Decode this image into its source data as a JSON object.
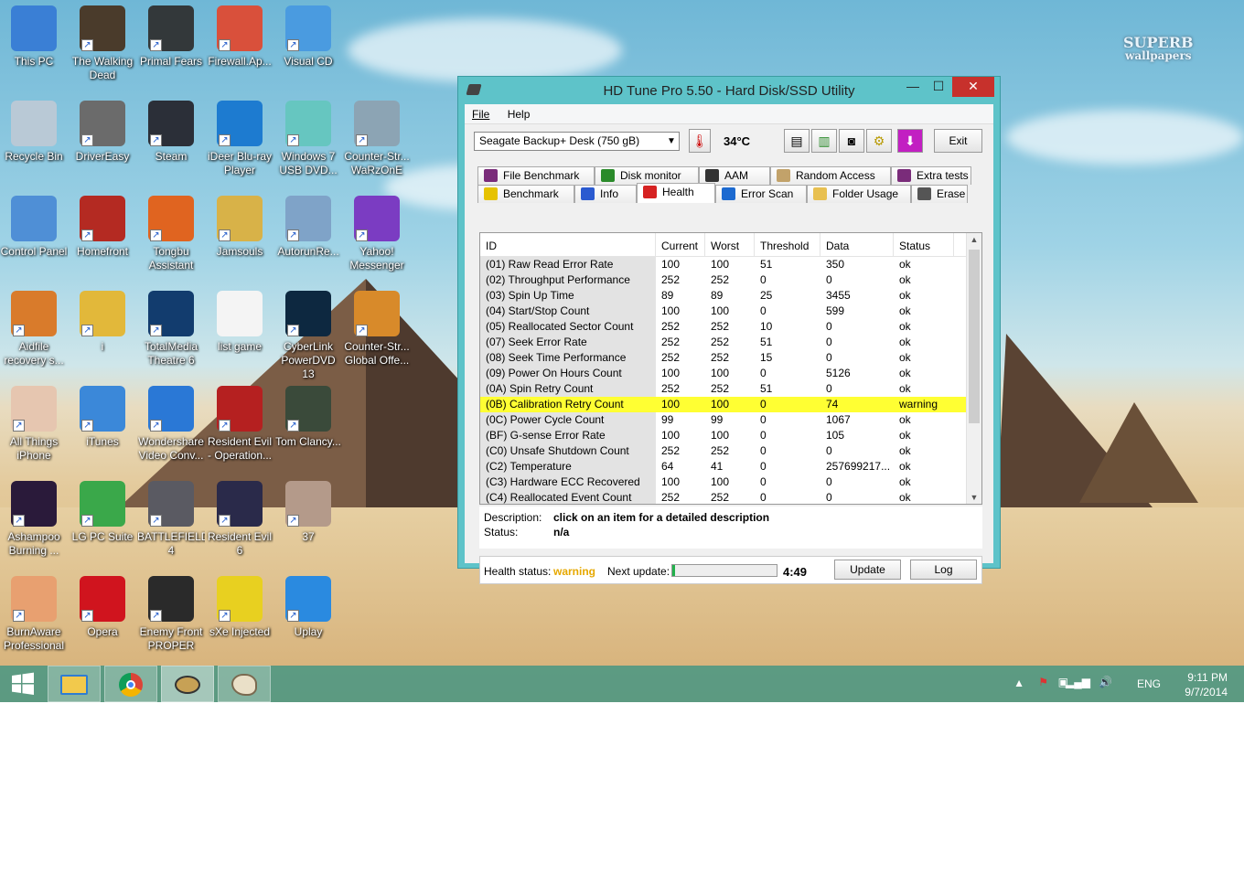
{
  "desktop": {
    "watermark": [
      "SUPERB",
      "wallpapers"
    ],
    "icons": [
      {
        "label": "This PC",
        "icon": "computer-icon",
        "color": "#3a7fd5"
      },
      {
        "label": "The Walking Dead",
        "icon": "game-icon",
        "color": "#4a3b2b"
      },
      {
        "label": "Primal Fears",
        "icon": "game-icon",
        "color": "#33383a"
      },
      {
        "label": "Firewall.Ap...",
        "icon": "firewall-icon",
        "color": "#d9503b"
      },
      {
        "label": "Visual CD",
        "icon": "disc-icon",
        "color": "#4a9be0"
      },
      {
        "label": "Recycle Bin",
        "icon": "recycle-bin-icon",
        "color": "#b9c9d6"
      },
      {
        "label": "DriverEasy",
        "icon": "magnifier-icon",
        "color": "#6b6b6b"
      },
      {
        "label": "Steam",
        "icon": "steam-icon",
        "color": "#2b2f38"
      },
      {
        "label": "iDeer Blu-ray Player",
        "icon": "play-icon",
        "color": "#1d7bd0"
      },
      {
        "label": "Windows 7 USB DVD...",
        "icon": "usb-icon",
        "color": "#66c6c0"
      },
      {
        "label": "Counter-Str... WaRzOnE",
        "icon": "game-icon",
        "color": "#8ca4b4"
      },
      {
        "label": "Control Panel",
        "icon": "control-panel-icon",
        "color": "#4f8fd6"
      },
      {
        "label": "Homefront",
        "icon": "game-icon",
        "color": "#b42a22"
      },
      {
        "label": "Tongbu Assistant",
        "icon": "tongbu-icon",
        "color": "#e06420"
      },
      {
        "label": "Jamsouls",
        "icon": "music-icon",
        "color": "#d8b248"
      },
      {
        "label": "AutorunRe...",
        "icon": "autorun-icon",
        "color": "#7fa3c8"
      },
      {
        "label": "Yahoo! Messenger",
        "icon": "yahoo-icon",
        "color": "#7b3cc2"
      },
      {
        "label": "Aidfile recovery s...",
        "icon": "tools-icon",
        "color": "#d97b2b"
      },
      {
        "label": "i",
        "icon": "chrome-icon",
        "color": "#e2b83a"
      },
      {
        "label": "TotalMedia Theatre 6",
        "icon": "play-icon",
        "color": "#123c6e"
      },
      {
        "label": "list game",
        "icon": "document-icon",
        "color": "#f4f4f4"
      },
      {
        "label": "CyberLink PowerDVD 13",
        "icon": "powerdvd-icon",
        "color": "#0d2840"
      },
      {
        "label": "Counter-Str... Global Offe...",
        "icon": "game-icon",
        "color": "#d88a2a"
      },
      {
        "label": "All Things iPhone",
        "icon": "shell-icon",
        "color": "#e6c6b0"
      },
      {
        "label": "iTunes",
        "icon": "itunes-icon",
        "color": "#3b88d9"
      },
      {
        "label": "Wondershare Video Conv...",
        "icon": "wondershare-icon",
        "color": "#2a78d6"
      },
      {
        "label": "Resident Evil - Operation...",
        "icon": "umbrella-icon",
        "color": "#b52020"
      },
      {
        "label": "Tom Clancy...",
        "icon": "game-icon",
        "color": "#3a4a3a"
      },
      {
        "label": "Ashampoo Burning ...",
        "icon": "ashampoo-icon",
        "color": "#2a1a3a"
      },
      {
        "label": "LG PC Suite",
        "icon": "sync-icon",
        "color": "#3aa84a"
      },
      {
        "label": "BATTLEFIELD 4",
        "icon": "game-icon",
        "color": "#5a5a62"
      },
      {
        "label": "Resident Evil 6",
        "icon": "game-icon",
        "color": "#2a2a4a"
      },
      {
        "label": "37",
        "icon": "image-icon",
        "color": "#b49a8a"
      },
      {
        "label": "BurnAware Professional",
        "icon": "burn-icon",
        "color": "#e8a070"
      },
      {
        "label": "Opera",
        "icon": "opera-icon",
        "color": "#d0141e"
      },
      {
        "label": "Enemy Front PROPER",
        "icon": "game-icon",
        "color": "#2a2a2a"
      },
      {
        "label": "sXe Injected",
        "icon": "sxe-icon",
        "color": "#e8d020"
      },
      {
        "label": "Uplay",
        "icon": "uplay-icon",
        "color": "#2a8ae0"
      }
    ]
  },
  "window": {
    "title": "HD Tune Pro 5.50 - Hard Disk/SSD Utility",
    "controls": {
      "minimize": "—",
      "maximize": "☐",
      "close": "✕"
    },
    "menu": [
      "File",
      "Help"
    ],
    "drive": "Seagate Backup+ Desk (750 gB)",
    "temperature": "34°C",
    "exit_label": "Exit",
    "tabs_top": [
      {
        "label": "File Benchmark",
        "icon": "file-benchmark-icon"
      },
      {
        "label": "Disk monitor",
        "icon": "disk-monitor-icon"
      },
      {
        "label": "AAM",
        "icon": "speaker-icon"
      },
      {
        "label": "Random Access",
        "icon": "random-access-icon"
      },
      {
        "label": "Extra tests",
        "icon": "extra-tests-icon"
      }
    ],
    "tabs_bottom": [
      {
        "label": "Benchmark",
        "icon": "benchmark-icon"
      },
      {
        "label": "Info",
        "icon": "info-icon"
      },
      {
        "label": "Health",
        "icon": "health-cross-icon",
        "active": true
      },
      {
        "label": "Error Scan",
        "icon": "error-scan-icon"
      },
      {
        "label": "Folder Usage",
        "icon": "folder-icon"
      },
      {
        "label": "Erase",
        "icon": "erase-icon"
      }
    ],
    "table": {
      "columns": [
        "ID",
        "Current",
        "Worst",
        "Threshold",
        "Data",
        "Status"
      ],
      "rows": [
        [
          "(01) Raw Read Error Rate",
          "100",
          "100",
          "51",
          "350",
          "ok"
        ],
        [
          "(02) Throughput Performance",
          "252",
          "252",
          "0",
          "0",
          "ok"
        ],
        [
          "(03) Spin Up Time",
          "89",
          "89",
          "25",
          "3455",
          "ok"
        ],
        [
          "(04) Start/Stop Count",
          "100",
          "100",
          "0",
          "599",
          "ok"
        ],
        [
          "(05) Reallocated Sector Count",
          "252",
          "252",
          "10",
          "0",
          "ok"
        ],
        [
          "(07) Seek Error Rate",
          "252",
          "252",
          "51",
          "0",
          "ok"
        ],
        [
          "(08) Seek Time Performance",
          "252",
          "252",
          "15",
          "0",
          "ok"
        ],
        [
          "(09) Power On Hours Count",
          "100",
          "100",
          "0",
          "5126",
          "ok"
        ],
        [
          "(0A) Spin Retry Count",
          "252",
          "252",
          "51",
          "0",
          "ok"
        ],
        [
          "(0B) Calibration Retry Count",
          "100",
          "100",
          "0",
          "74",
          "warning"
        ],
        [
          "(0C) Power Cycle Count",
          "99",
          "99",
          "0",
          "1067",
          "ok"
        ],
        [
          "(BF) G-sense Error Rate",
          "100",
          "100",
          "0",
          "105",
          "ok"
        ],
        [
          "(C0) Unsafe Shutdown Count",
          "252",
          "252",
          "0",
          "0",
          "ok"
        ],
        [
          "(C2) Temperature",
          "64",
          "41",
          "0",
          "257699217...",
          "ok"
        ],
        [
          "(C3) Hardware ECC Recovered",
          "100",
          "100",
          "0",
          "0",
          "ok"
        ],
        [
          "(C4) Reallocated Event Count",
          "252",
          "252",
          "0",
          "0",
          "ok"
        ]
      ],
      "highlight_color": "#ffff33"
    },
    "description": {
      "desc_label": "Description:",
      "desc_value": "click on an item for a detailed description",
      "status_label": "Status:",
      "status_value": "n/a"
    },
    "status_bar": {
      "health_label": "Health status:",
      "health_value": "warning",
      "health_color": "#e6a800",
      "next_update_label": "Next update:",
      "progress": 0.03,
      "countdown": "4:49",
      "update_label": "Update",
      "log_label": "Log"
    }
  },
  "taskbar": {
    "items": [
      "start-icon",
      "file-explorer-icon",
      "chrome-icon",
      "hd-tune-icon",
      "paint-icon"
    ],
    "tray": {
      "language": "ENG",
      "time": "9:11 PM",
      "date": "9/7/2014"
    }
  }
}
